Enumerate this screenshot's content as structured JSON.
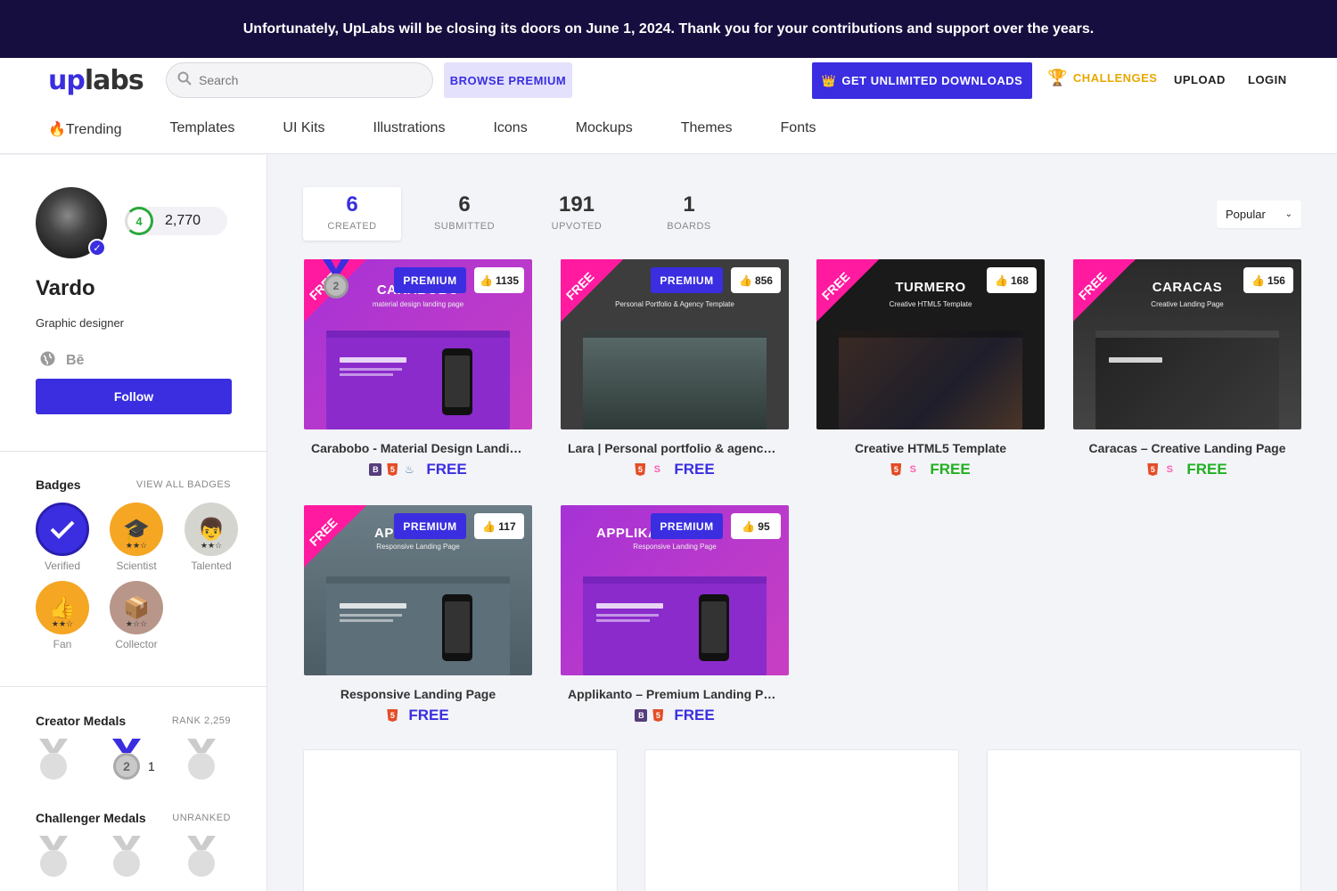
{
  "banner": {
    "text": "Unfortunately, UpLabs will be closing its doors on June 1, 2024. Thank you for your contributions and support over the years."
  },
  "header": {
    "logo_up": "up",
    "logo_labs": "labs",
    "search_placeholder": "Search",
    "browse_label": "BROWSE PREMIUM",
    "get_unlimited_label": "GET UNLIMITED DOWNLOADS",
    "challenges_label": "CHALLENGES",
    "upload_label": "UPLOAD",
    "login_label": "LOGIN",
    "accent_color": "#3a2ee0"
  },
  "nav": {
    "items": [
      "🔥Trending",
      "Templates",
      "UI Kits",
      "Illustrations",
      "Icons",
      "Mockups",
      "Themes",
      "Fonts"
    ]
  },
  "profile": {
    "level": "4",
    "points": "2,770",
    "name": "Vardo",
    "title": "Graphic designer",
    "behance": "Bē",
    "follow_label": "Follow"
  },
  "badges": {
    "title": "Badges",
    "view_all": "VIEW ALL BADGES",
    "items": [
      {
        "label": "Verified",
        "icon": "check-icon"
      },
      {
        "label": "Scientist",
        "icon": "graduation-cap-icon"
      },
      {
        "label": "Talented",
        "icon": "person-icon"
      },
      {
        "label": "Fan",
        "icon": "thumbs-up-icon"
      },
      {
        "label": "Collector",
        "icon": "box-icon"
      }
    ]
  },
  "creator_medals": {
    "title": "Creator Medals",
    "rank": "RANK 2,259",
    "count": "1",
    "medal_number": "2"
  },
  "challenger_medals": {
    "title": "Challenger Medals",
    "rank": "UNRANKED"
  },
  "stats": [
    {
      "num": "6",
      "label": "CREATED"
    },
    {
      "num": "6",
      "label": "SUBMITTED"
    },
    {
      "num": "191",
      "label": "UPVOTED"
    },
    {
      "num": "1",
      "label": "BOARDS"
    }
  ],
  "sort": {
    "value": "Popular"
  },
  "cards": [
    {
      "name": "Carabobo - Material Design Landing Page",
      "likes": "1135",
      "premium": "PREMIUM",
      "free": "FREE",
      "thumb_title": "CARABOBO",
      "thumb_sub": "material design landing page"
    },
    {
      "name": "Lara | Personal portfolio & agency template",
      "likes": "856",
      "premium": "PREMIUM",
      "free": "FREE",
      "thumb_title": "",
      "thumb_sub": "Personal Portfolio & Agency Template"
    },
    {
      "name": "Creative HTML5 Template",
      "likes": "168",
      "free": "FREE",
      "thumb_title": "TURMERO",
      "thumb_sub": "Creative HTML5 Template"
    },
    {
      "name": "Caracas – Creative Landing Page",
      "likes": "156",
      "free": "FREE",
      "thumb_title": "CARACAS",
      "thumb_sub": "Creative Landing Page"
    },
    {
      "name": "Responsive Landing Page",
      "likes": "117",
      "premium": "PREMIUM",
      "free": "FREE",
      "thumb_title": "AP",
      "thumb_sub": "Responsive Landing Page"
    },
    {
      "name": "Applikanto – Premium Landing Page",
      "likes": "95",
      "premium": "PREMIUM",
      "free": "FREE",
      "thumb_title": "APPLIKA",
      "thumb_sub": "Responsive Landing Page"
    }
  ],
  "colors": {
    "free_green": "#22b022",
    "free_blue": "#3a2ee0",
    "ribbon_pink": "#ff1aa0"
  }
}
